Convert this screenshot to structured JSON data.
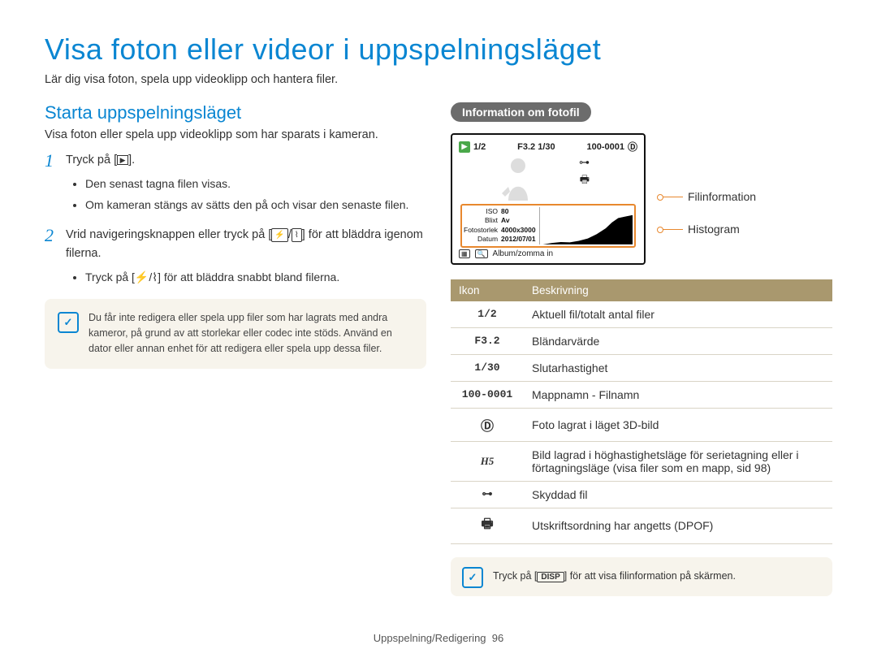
{
  "page_title": "Visa foton eller videor i uppspelningsläget",
  "page_subtitle": "Lär dig visa foton, spela upp videoklipp och hantera filer.",
  "left": {
    "h2": "Starta uppspelningsläget",
    "intro": "Visa foton eller spela upp videoklipp som har sparats i kameran.",
    "steps": [
      {
        "num": "1",
        "text_prefix": "Tryck på [",
        "text_suffix": "].",
        "bullets": [
          "Den senast tagna filen visas.",
          "Om kameran stängs av sätts den på och visar den senaste filen."
        ]
      },
      {
        "num": "2",
        "text_prefix": "Vrid navigeringsknappen eller tryck på [",
        "text_mid": "/",
        "text_suffix": "] för att bläddra igenom filerna.",
        "bullets": [
          "Tryck på [⚡/⌇] för att bläddra snabbt bland filerna."
        ]
      }
    ],
    "note": "Du får inte redigera eller spela upp filer som har lagrats med andra kameror, på grund av att storlekar eller codec inte stöds. Använd en dator eller annan enhet för att redigera eller spela upp dessa filer."
  },
  "right": {
    "pill_label": "Information om fotofil",
    "screen": {
      "top_count": "1/2",
      "top_f": "F3.2",
      "top_shutter": "1/30",
      "top_file": "100-0001",
      "info_rows": {
        "iso_label": "ISO",
        "iso_val": "80",
        "blixt_label": "Blixt",
        "blixt_val": "Av",
        "size_label": "Fotostorlek",
        "size_val": "4000x3000",
        "date_label": "Datum",
        "date_val": "2012/07/01"
      },
      "bottom_label": "Album/zomma in"
    },
    "callout1": "Filinformation",
    "callout2": "Histogram",
    "table_headers": {
      "icon": "Ikon",
      "desc": "Beskrivning"
    },
    "table_rows": [
      {
        "icon": "1/2",
        "desc": "Aktuell fil/totalt antal filer"
      },
      {
        "icon": "F3.2",
        "desc": "Bländarvärde"
      },
      {
        "icon": "1/30",
        "desc": "Slutarhastighet"
      },
      {
        "icon": "100-0001",
        "desc": "Mappnamn - Filnamn"
      },
      {
        "icon": "3d",
        "desc": "Foto lagrat i läget 3D-bild"
      },
      {
        "icon": "H5",
        "desc": "Bild lagrad i höghastighetsläge för serietagning eller i förtagningsläge (visa filer som en mapp, sid 98)"
      },
      {
        "icon": "key",
        "desc": "Skyddad fil"
      },
      {
        "icon": "print",
        "desc": "Utskriftsordning har angetts (DPOF)"
      }
    ],
    "tip_prefix": "Tryck på [",
    "tip_key": "DISP",
    "tip_suffix": "] för att visa filinformation på skärmen."
  },
  "footer": {
    "section": "Uppspelning/Redigering",
    "page_num": "96"
  }
}
